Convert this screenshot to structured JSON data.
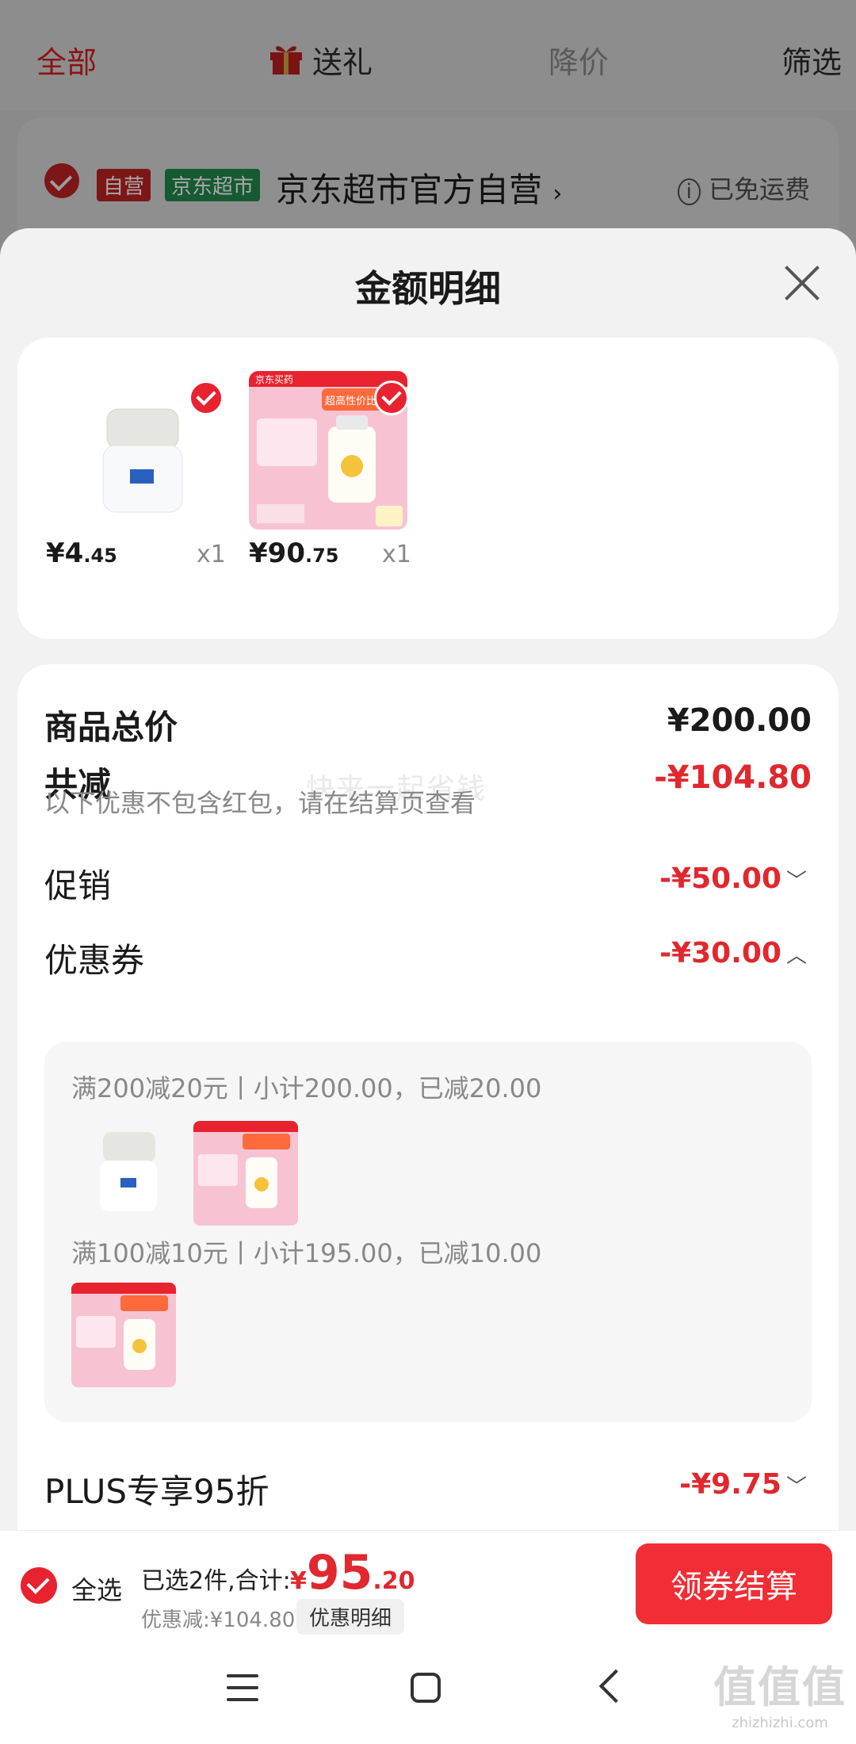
{
  "bg": {
    "tabs": [
      "全部",
      "送礼",
      "降价",
      "筛选"
    ],
    "store": {
      "tag_self": "自营",
      "tag_market": "京东超市",
      "name": "京东超市官方自营",
      "chevron": "›",
      "free_shipping": "已免运费"
    }
  },
  "sheet": {
    "title": "金额明细",
    "products": [
      {
        "price_int": "¥4",
        "price_dec": ".45",
        "qty": "x1",
        "icon": "jar-product-icon"
      },
      {
        "price_int": "¥90",
        "price_dec": ".75",
        "qty": "x1",
        "icon": "promo-product-icon"
      }
    ],
    "product2_img_text": {
      "brand": "京东买药",
      "headline": "超高性价比"
    },
    "summary": {
      "total_label": "商品总价",
      "total_value": "¥200.00",
      "reduce_label": "共减",
      "reduce_value": "-¥104.80",
      "note": "以下优惠不包含红包，请在结算页查看",
      "watermark": "快来一起省钱",
      "promo_label": "促销",
      "promo_value": "-¥50.00",
      "coupon_label": "优惠券",
      "coupon_value": "-¥30.00",
      "coupons": [
        {
          "line": "满200减20元丨小计200.00，已减20.00"
        },
        {
          "line": "满100减10元丨小计195.00，已减10.00"
        }
      ],
      "plus_label": "PLUS专享95折",
      "plus_value": "-¥9.75"
    }
  },
  "bottom": {
    "select_all": "全选",
    "selected": "已选2件,合计:",
    "total_cur": "¥",
    "total_int": "95",
    "total_dec": ".20",
    "discount": "优惠减:¥104.80",
    "detail_button": "优惠明细",
    "checkout": "领券结算"
  },
  "site": {
    "mark": "值值值",
    "url": "zhizhizhi.com"
  },
  "colors": {
    "accent": "#e8232f",
    "checkout": "#f12d35",
    "red_text": "#e0282e"
  }
}
